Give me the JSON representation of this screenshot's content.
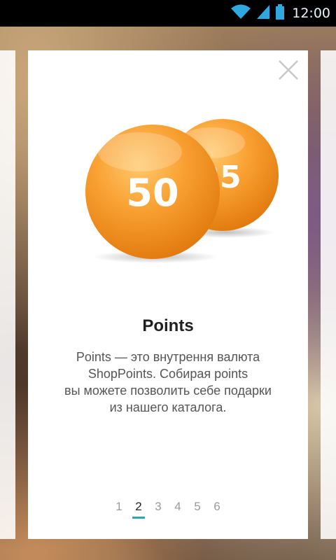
{
  "status_bar": {
    "time": "12:00",
    "icons": [
      "wifi-icon",
      "signal-icon",
      "battery-icon"
    ]
  },
  "card": {
    "coins": [
      {
        "label": "50"
      },
      {
        "label": "25"
      }
    ],
    "title": "Points",
    "description_lines": [
      "Points — это внутрення валюта",
      "ShopPoints. Собирая points",
      "вы можете позволить себе подарки",
      "из нашего каталога."
    ],
    "pager": {
      "pages": [
        "1",
        "2",
        "3",
        "4",
        "5",
        "6"
      ],
      "current_index": 1
    }
  },
  "colors": {
    "accent": "#2aa9b0",
    "coin": "#f7931e"
  }
}
